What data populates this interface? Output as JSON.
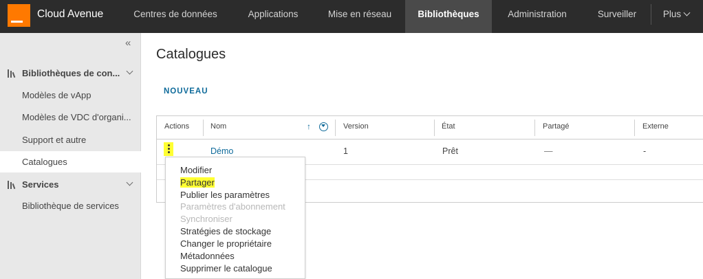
{
  "app": {
    "brand_name": "Cloud Avenue",
    "brand_color": "#ff7900",
    "logo_icon": "orange-square-logo"
  },
  "nav": {
    "items": [
      {
        "label": "Centres de données"
      },
      {
        "label": "Applications"
      },
      {
        "label": "Mise en réseau"
      },
      {
        "label": "Bibliothèques",
        "active": true
      },
      {
        "label": "Administration"
      },
      {
        "label": "Surveiller"
      }
    ],
    "more_label": "Plus"
  },
  "sidebar": {
    "collapse_icon": "double-chevron-left-icon",
    "collapse_glyph": "«",
    "groups": [
      {
        "label": "Bibliothèques de con...",
        "icon": "library-icon",
        "items": [
          {
            "label": "Modèles de vApp"
          },
          {
            "label": "Modèles de VDC d'organi..."
          },
          {
            "label": "Support et autre"
          },
          {
            "label": "Catalogues",
            "active": true
          }
        ]
      },
      {
        "label": "Services",
        "icon": "library-icon",
        "items": [
          {
            "label": "Bibliothèque de services"
          }
        ]
      }
    ]
  },
  "main": {
    "title": "Catalogues",
    "new_button": "NOUVEAU",
    "columns": [
      "Actions",
      "Nom",
      "Version",
      "État",
      "Partagé",
      "Externe"
    ],
    "sort_icon": "sort-ascending-icon",
    "sort_glyph": "↑",
    "filter_icon": "filter-icon",
    "rows": [
      {
        "nom": "Démo",
        "version": "1",
        "etat": "Prêt",
        "partage": "—",
        "externe": "-"
      }
    ]
  },
  "action_menu": {
    "items": [
      {
        "label": "Modifier",
        "enabled": true
      },
      {
        "label": "Partager",
        "enabled": true,
        "highlighted": true
      },
      {
        "label": "Publier les paramètres",
        "enabled": true
      },
      {
        "label": "Paramètres d'abonnement",
        "enabled": false
      },
      {
        "label": "Synchroniser",
        "enabled": false
      },
      {
        "label": "Stratégies de stockage",
        "enabled": true
      },
      {
        "label": "Changer le propriétaire",
        "enabled": true
      },
      {
        "label": "Métadonnées",
        "enabled": true
      },
      {
        "label": "Supprimer le catalogue",
        "enabled": true
      }
    ]
  },
  "colors": {
    "topbar": "#2c2c2c",
    "link": "#0e6a9a",
    "highlight": "#ffff33"
  }
}
